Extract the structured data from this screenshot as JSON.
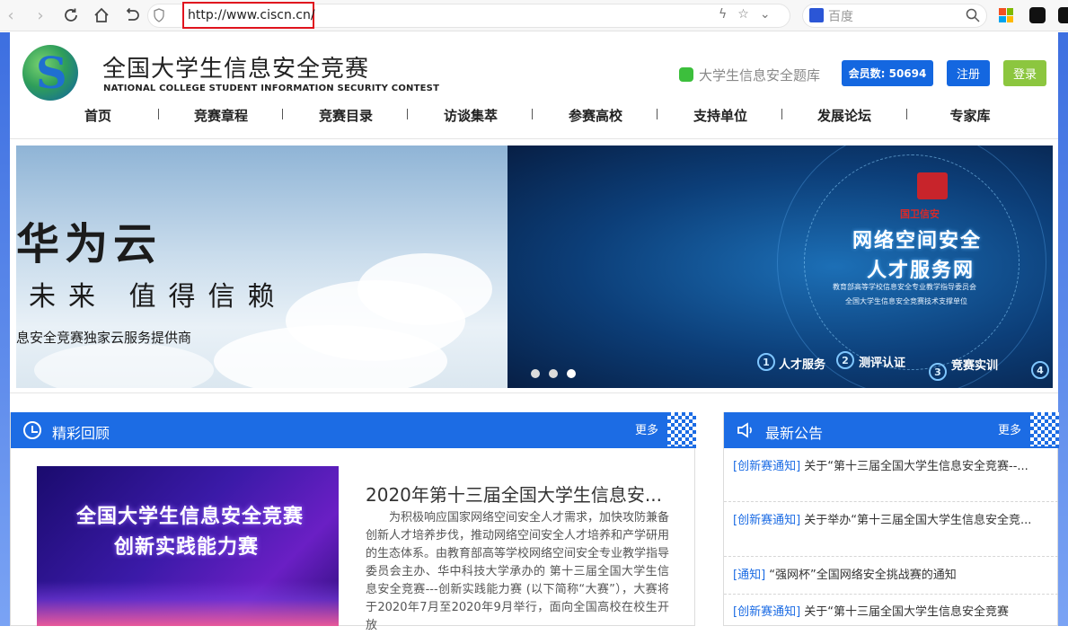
{
  "browser": {
    "url": "http://www.ciscn.cn/",
    "search_placeholder": "百度"
  },
  "header": {
    "title": "全国大学生信息安全竞赛",
    "subtitle": "NATIONAL COLLEGE STUDENT INFORMATION SECURITY CONTEST",
    "wechat_link": "大学生信息安全题库",
    "member_count": "会员数: 50694",
    "register": "注册",
    "login": "登录"
  },
  "nav": {
    "items": [
      "首页",
      "竞赛章程",
      "竞赛目录",
      "访谈集萃",
      "参赛高校",
      "支持单位",
      "发展论坛",
      "专家库"
    ]
  },
  "banner": {
    "left_line1": "华为云",
    "left_line2": "未来 值得信赖",
    "left_line3": "息安全竞赛独家云服务提供商",
    "right_brand": "国卫信安",
    "right_title1": "网络空间安全",
    "right_title2": "人才服务网",
    "right_sub1": "教育部高等学校信息安全专业教学指导委员会",
    "right_sub2": "全国大学生信息安全竞赛技术支撑单位",
    "features": [
      {
        "num": "1",
        "label": "人才服务"
      },
      {
        "num": "2",
        "label": "测评认证"
      },
      {
        "num": "3",
        "label": "竞赛实训"
      },
      {
        "num": "4",
        "label": ""
      }
    ],
    "slide_count": 3,
    "active_slide": 3
  },
  "review": {
    "title": "精彩回顾",
    "more": "更多",
    "image_line1": "全国大学生信息安全竞赛",
    "image_line2": "创新实践能力赛",
    "article_title": "2020年第十三届全国大学生信息安...",
    "article_body": "为积极响应国家网络空间安全人才需求，加快攻防兼备创新人才培养步伐，推动网络空间安全人才培养和产学研用的生态体系。由教育部高等学校网络空间安全专业教学指导委员会主办、华中科技大学承办的 第十三届全国大学生信息安全竞赛---创新实践能力赛 (以下简称“大赛”），大赛将于2020年7月至2020年9月举行，面向全国高校在校生开放"
  },
  "notices": {
    "title": "最新公告",
    "more": "更多",
    "items": [
      {
        "tag": "[创新赛通知]",
        "text": " 关于“第十三届全国大学生信息安全竞赛--..."
      },
      {
        "tag": "[创新赛通知]",
        "text": " 关于举办“第十三届全国大学生信息安全竞..."
      },
      {
        "tag": "[通知]",
        "text": " “强网杯”全国网络安全挑战赛的通知"
      },
      {
        "tag": "[创新赛通知]",
        "text": " 关于“第十三届全国大学生信息安全竞赛"
      }
    ]
  },
  "colors": {
    "primary_blue": "#1c6ce4",
    "login_green": "#8cc63f",
    "url_highlight": "#e0141e"
  }
}
